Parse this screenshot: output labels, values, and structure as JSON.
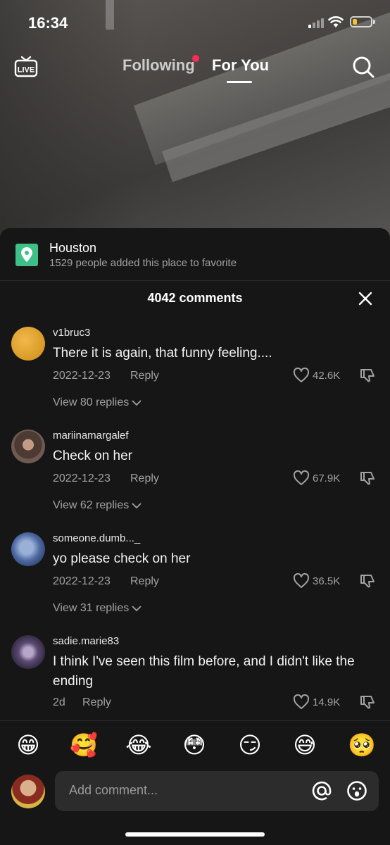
{
  "status_bar": {
    "time": "16:34",
    "battery_level": 0.25
  },
  "top_nav": {
    "following_label": "Following",
    "for_you_label": "For You",
    "live_label": "LIVE"
  },
  "place": {
    "title": "Houston",
    "subtitle": "1529 people added this place to favorite",
    "icon": "location-pin-icon"
  },
  "comments_header": {
    "count_label": "4042 comments"
  },
  "comments": [
    {
      "user": "v1bruc3",
      "text": "There it is again, that funny feeling....",
      "date": "2022-12-23",
      "reply_label": "Reply",
      "likes": "42.6K",
      "view_replies": "View 80 replies"
    },
    {
      "user": "mariinamargalef",
      "text": "Check on her",
      "date": "2022-12-23",
      "reply_label": "Reply",
      "likes": "67.9K",
      "view_replies": "View 62 replies"
    },
    {
      "user": "someone.dumb..._",
      "text": "yo please check on her",
      "date": "2022-12-23",
      "reply_label": "Reply",
      "likes": "36.5K",
      "view_replies": "View 31 replies"
    },
    {
      "user": "sadie.marie83",
      "text": "I think I've seen this film before, and I didn't like the ending",
      "date": "2d",
      "reply_label": "Reply",
      "likes": "14.9K"
    }
  ],
  "emoji_bar": [
    "😁",
    "🥰",
    "😂",
    "😳",
    "😏",
    "😅",
    "🥺"
  ],
  "input": {
    "placeholder": "Add comment..."
  },
  "colors": {
    "accent": "#fe2c55",
    "place_icon": "#3fc089",
    "sheet_bg": "#161616",
    "input_bg": "#2c2c2c"
  }
}
